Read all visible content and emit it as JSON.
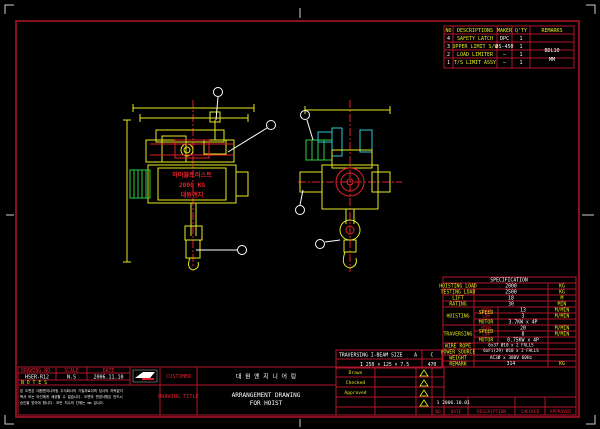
{
  "drawing": {
    "background": "#000000",
    "colors": {
      "frame": "#b3142a",
      "border": "#ffffff",
      "yellow": "#e8e820",
      "green": "#2ad03a",
      "cyan": "#29c9d9",
      "red": "#e0202a",
      "white": "#ffffff",
      "gray": "#9a9a9a"
    }
  },
  "parts_list": {
    "headers": [
      "NO",
      "DESCRIPTIONS",
      "MAKER",
      "Q'TY",
      "REMARKS"
    ],
    "rows": [
      {
        "no": "4",
        "desc": "SAFETY LATCH",
        "maker": "DPC",
        "qty": "1",
        "remarks": ""
      },
      {
        "no": "3",
        "desc": "UPPER LIMIT S/W",
        "maker": "DS-450",
        "qty": "1",
        "remarks": "BDL10"
      },
      {
        "no": "2",
        "desc": "LOAD LIMITER",
        "maker": "—",
        "qty": "1",
        "remarks": "MM"
      },
      {
        "no": "1",
        "desc": "T/S LIMIT ASSY",
        "maker": "—",
        "qty": "1",
        "remarks": ""
      }
    ]
  },
  "hoist_label": {
    "line1": "하이블트러스트",
    "line2": "2000 KG",
    "line3": "대원엔지"
  },
  "spec": {
    "title": "SPECIFICATION",
    "rows": [
      {
        "label": "HOISTING LOAD",
        "value": "2000",
        "unit": "KG"
      },
      {
        "label": "TESTING LOAD",
        "value": "2500",
        "unit": "KG"
      },
      {
        "label": "LIFT",
        "value": "18",
        "unit": "M"
      },
      {
        "label": "RATING",
        "value": "30",
        "unit": "MIN"
      }
    ],
    "hoisting": {
      "group": "HOISTING",
      "rows": [
        {
          "label": "SPEED",
          "sub": "HIGH",
          "value": "13",
          "unit": "M/MIN"
        },
        {
          "label": "",
          "sub": "LOW",
          "value": "3",
          "unit": "M/MIN"
        },
        {
          "label": "MOTOR",
          "sub": "",
          "value": "3.7KW x 4P",
          "unit": ""
        }
      ]
    },
    "traversing": {
      "group": "TRAVERSING",
      "rows": [
        {
          "label": "SPEED",
          "sub": "HIGH",
          "value": "20",
          "unit": "M/MIN"
        },
        {
          "label": "",
          "sub": "LOW",
          "value": "8",
          "unit": "M/MIN"
        },
        {
          "label": "MOTOR",
          "sub": "",
          "value": "0.75KW x 4P",
          "unit": ""
        }
      ]
    },
    "wire_rope": {
      "label": "WIRE ROPE",
      "line1": "6x37 Ø10 x 2 FALLS",
      "line2": "6xFi(29) Ø10 x 2 FALLS"
    },
    "power_source": {
      "label": "POWER SOURCE",
      "value": "AC3Ø x 380V 60Hz"
    },
    "weight": {
      "label": "WEIGHT",
      "value": "314",
      "unit": "KG"
    },
    "remark": {
      "label": "REMARK",
      "value": ""
    }
  },
  "traversing_note": {
    "text": "TRAVERSING I-BEAM SIZE",
    "size": "I 250 × 125 × 7.5",
    "dim1": "A",
    "dim2": "C",
    "dim3": "470"
  },
  "title_block": {
    "drawing_no_label": "DRAWING NO.",
    "drawing_no": "HSER-R12",
    "scale_label": "SCALE",
    "scale": "N.S",
    "date_label": "DATE",
    "date": "2006.11.10",
    "notes_title": "N O T E S",
    "notes": [
      "본 도면은 대원엔지니어링 주식회사의 기밀자료이며 당사의 허락없이",
      "복사 또는 타인에게 제공할 수 없습니다. 도면의 변경사항은 반드시",
      "승인을 받아야 합니다. 모든 치수의 단위는 mm 입니다."
    ],
    "customer_label": "CUSTOMER",
    "drawing_title_label": "DRAWING TITLE",
    "company": "대 원 엔 지 니 어 링",
    "title_line1": "ARRANGEMENT DRAWING",
    "title_line2": "FOR HOIST",
    "approvals": [
      "Drawn",
      "Checked",
      "Approved"
    ],
    "rev_no": "1",
    "rev_date": "2006.10.01",
    "rev_headers": [
      "NO",
      "DATE",
      "DESCRIPTION",
      "CHECKED",
      "APPROVED"
    ]
  }
}
